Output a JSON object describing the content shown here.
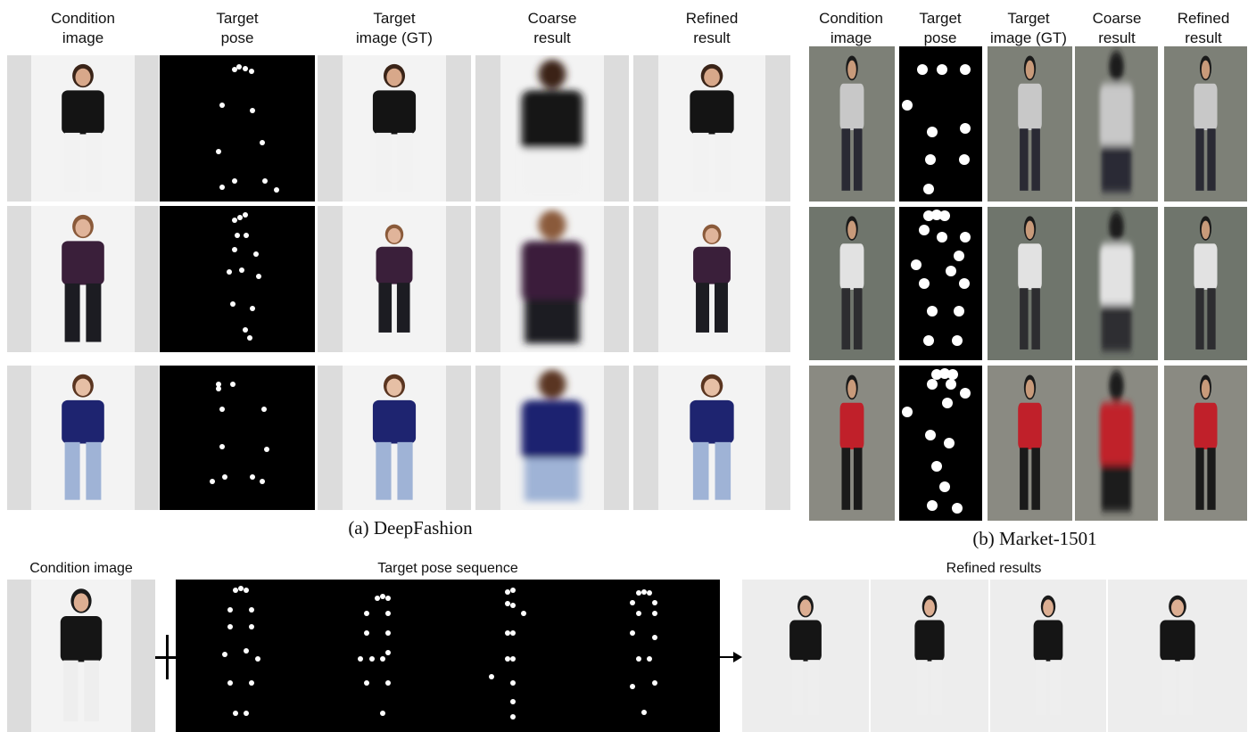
{
  "deepfashion": {
    "headers": [
      "Condition\nimage",
      "Target\npose",
      "Target\nimage (GT)",
      "Coarse\nresult",
      "Refined\nresult"
    ],
    "caption": "(a)  DeepFashion",
    "rows": [
      {
        "top_color": "#141414",
        "bottom_color": "#f2f2f2",
        "skin": "#d8a88a",
        "hair": "#3a2418"
      },
      {
        "top_color": "#3a1f3a",
        "bottom_color": "#1c1c22",
        "skin": "#e0b49a",
        "hair": "#8a5a3a"
      },
      {
        "top_color": "#1e2470",
        "bottom_color": "#9fb3d6",
        "skin": "#e6bfa5",
        "hair": "#5a3520"
      }
    ]
  },
  "market": {
    "headers": [
      "Condition\nimage",
      "Target\npose",
      "Target\nimage (GT)",
      "Coarse\nresult",
      "Refined\nresult"
    ],
    "caption": "(b) Market-1501",
    "rows": [
      {
        "top_color": "#c8c8c8",
        "bottom_color": "#2a2a34",
        "bg": "#7d8077"
      },
      {
        "top_color": "#e2e2e2",
        "bottom_color": "#2d2d30",
        "bg": "#6f756c"
      },
      {
        "top_color": "#c0202a",
        "bottom_color": "#1a1a1a",
        "bg": "#8a8a82"
      }
    ]
  },
  "sequence": {
    "condition_label": "Condition image",
    "pose_label": "Target pose sequence",
    "results_label": "Refined results",
    "outfit": {
      "top_color": "#151515",
      "bottom_color": "#eeeeee",
      "hat": "#1a1a1a",
      "skin": "#dcae92"
    }
  },
  "icons": {
    "plus": "plus-icon",
    "arrow": "arrow-right-icon"
  }
}
